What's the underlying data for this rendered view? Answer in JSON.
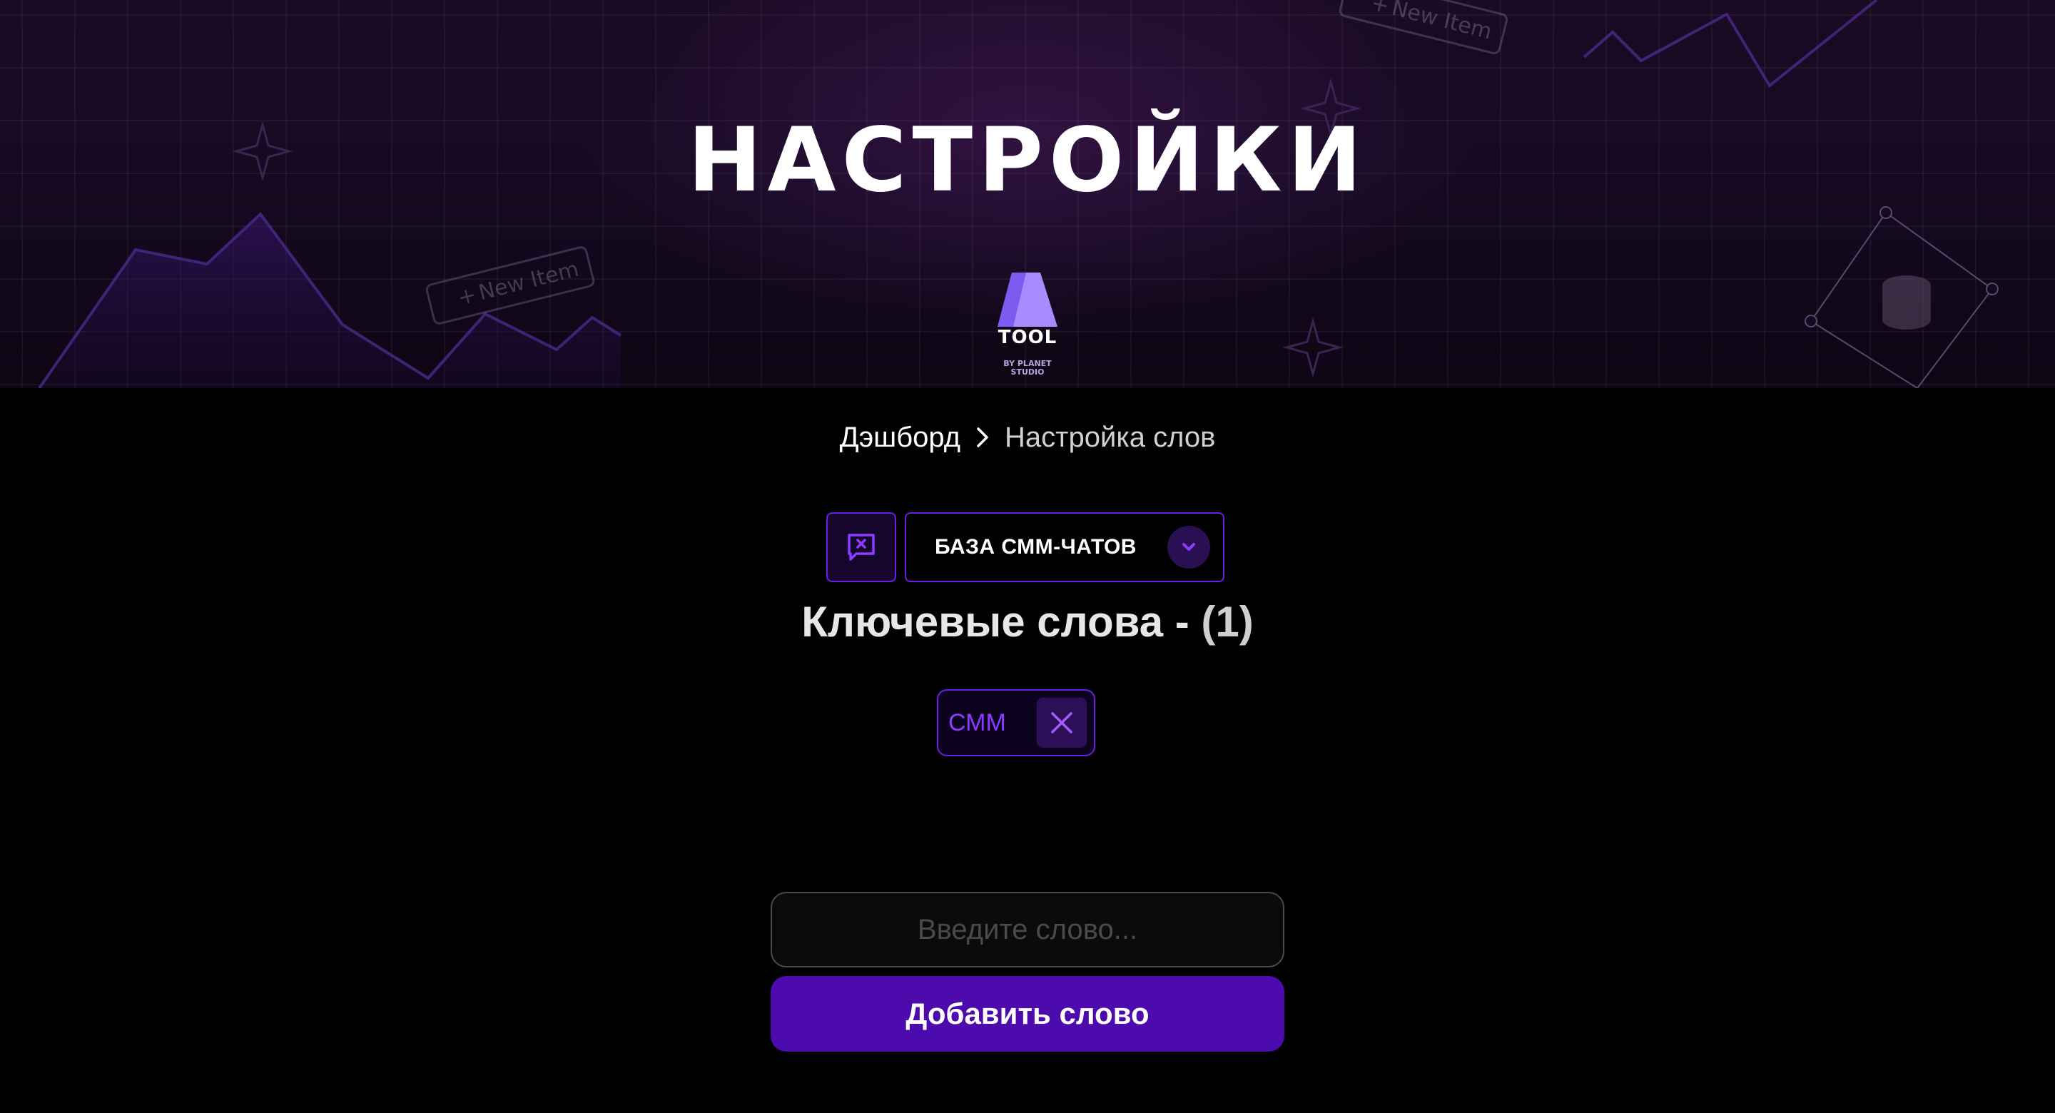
{
  "hero": {
    "title": "НАСТРОЙКИ",
    "logo": {
      "name": "TOOL",
      "tagline_line1": "BY PLANET",
      "tagline_line2": "STUDIO"
    },
    "decor_chip_text": "New Item"
  },
  "breadcrumb": {
    "home": "Дэшборд",
    "current": "Настройка слов"
  },
  "selector": {
    "selected": "БАЗА СММ-ЧАТОВ"
  },
  "keywords": {
    "title": "Ключевые слова - ",
    "count": "(1)",
    "items": [
      {
        "label": "СММ"
      }
    ]
  },
  "form": {
    "placeholder": "Введите слово...",
    "add_button": "Добавить слово"
  },
  "colors": {
    "accent": "#6b1fe0",
    "button": "#4d0aad",
    "chip_text": "#8c3cff"
  }
}
